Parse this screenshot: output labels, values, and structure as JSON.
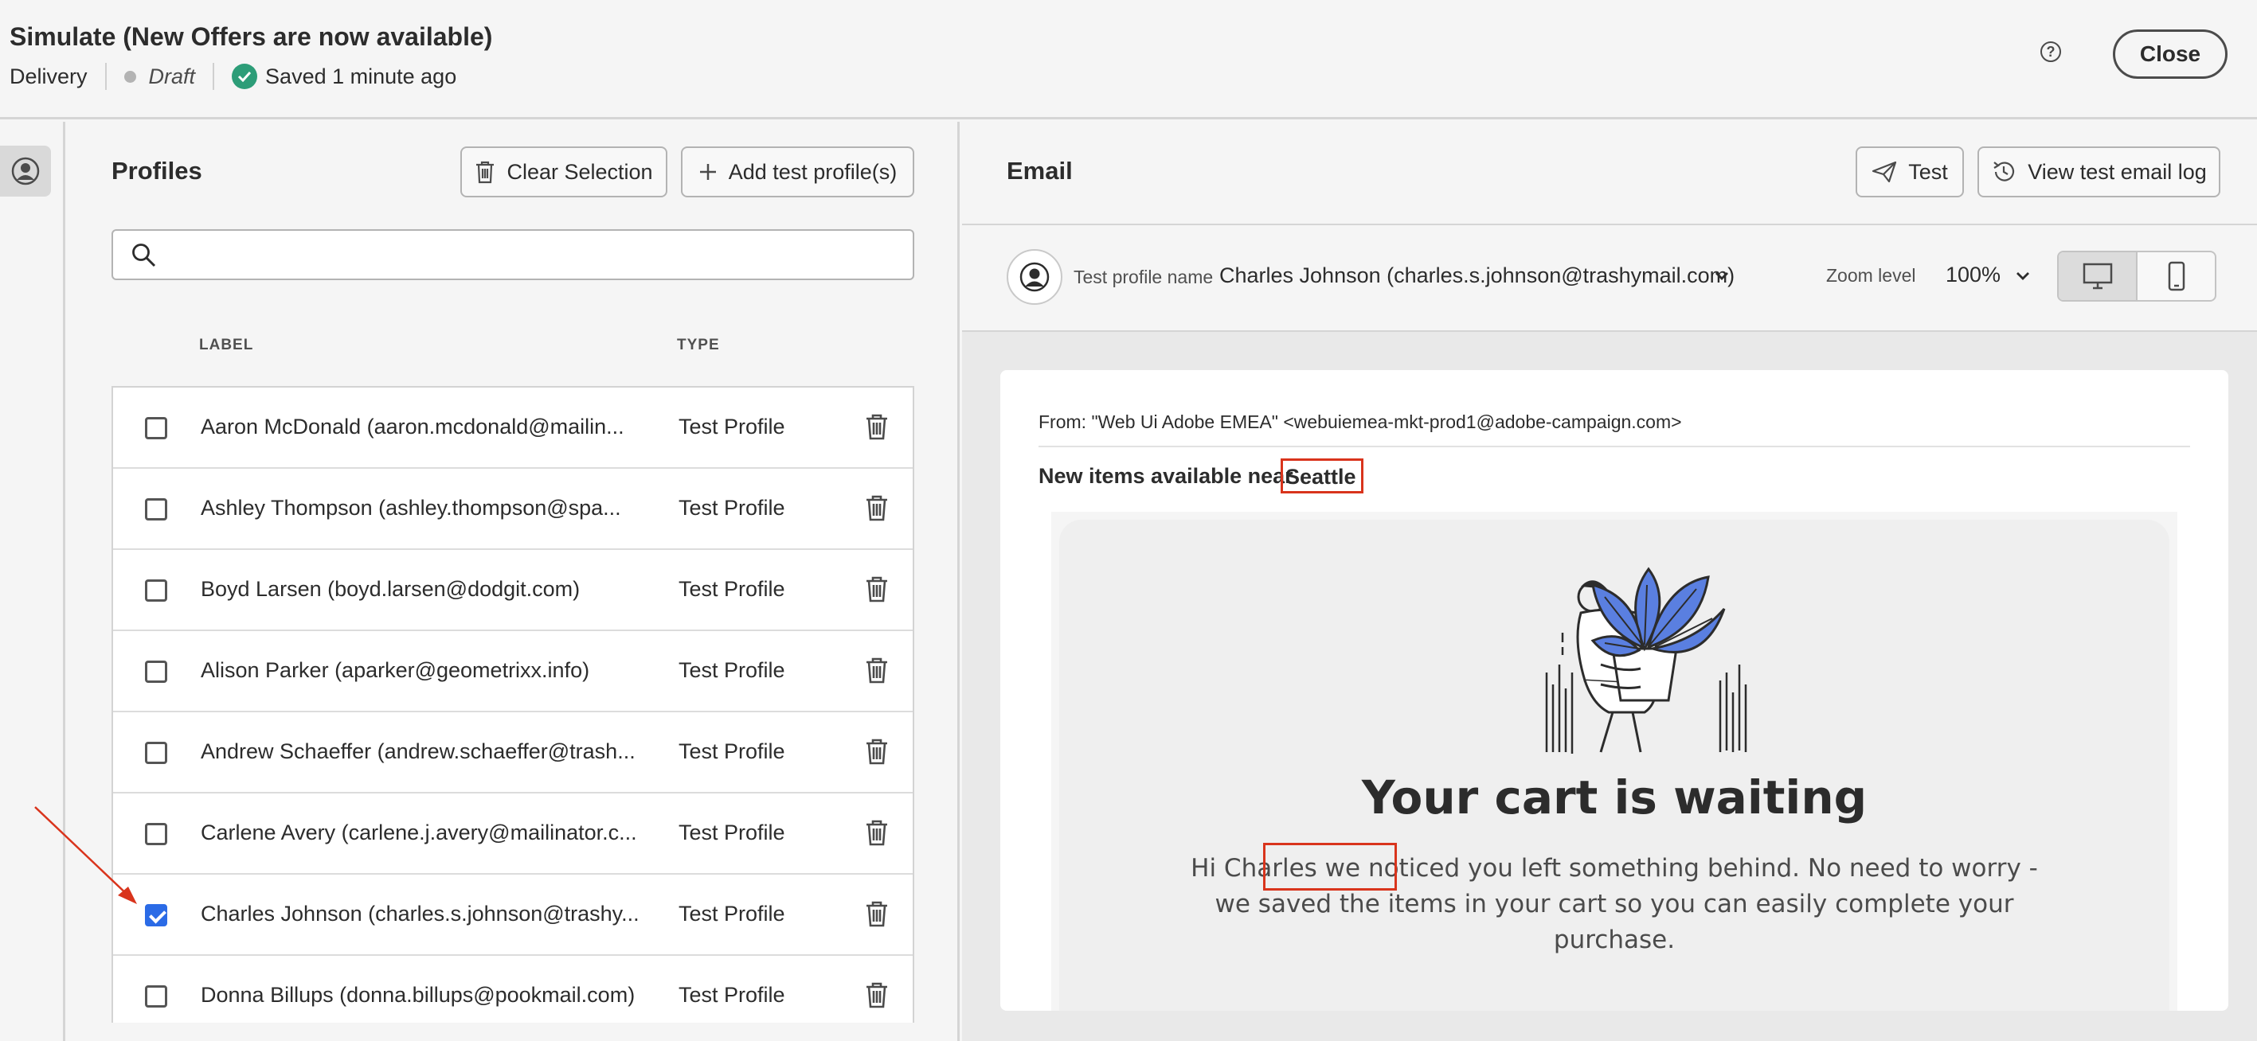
{
  "header": {
    "title": "Simulate (New Offers are now available)",
    "type": "Delivery",
    "status": "Draft",
    "saved": "Saved 1 minute ago",
    "close_label": "Close",
    "help_glyph": "?"
  },
  "profiles": {
    "title": "Profiles",
    "clear_label": "Clear Selection",
    "add_label": "Add test profile(s)",
    "search_placeholder": "",
    "columns": {
      "label": "LABEL",
      "type": "TYPE"
    },
    "rows": [
      {
        "label": "Aaron McDonald (aaron.mcdonald@mailin...",
        "type": "Test Profile",
        "checked": false
      },
      {
        "label": "Ashley Thompson (ashley.thompson@spa...",
        "type": "Test Profile",
        "checked": false
      },
      {
        "label": "Boyd Larsen (boyd.larsen@dodgit.com)",
        "type": "Test Profile",
        "checked": false
      },
      {
        "label": "Alison Parker (aparker@geometrixx.info)",
        "type": "Test Profile",
        "checked": false
      },
      {
        "label": "Andrew Schaeffer (andrew.schaeffer@trash...",
        "type": "Test Profile",
        "checked": false
      },
      {
        "label": "Carlene Avery (carlene.j.avery@mailinator.c...",
        "type": "Test Profile",
        "checked": false
      },
      {
        "label": "Charles Johnson (charles.s.johnson@trashy...",
        "type": "Test Profile",
        "checked": true
      },
      {
        "label": "Donna Billups (donna.billups@pookmail.com)",
        "type": "Test Profile",
        "checked": false
      }
    ]
  },
  "email": {
    "title": "Email",
    "test_label": "Test",
    "log_label": "View test email log",
    "test_profile_label": "Test profile name",
    "test_profile_value": "Charles Johnson (charles.s.johnson@trashymail.com)",
    "zoom_label": "Zoom level",
    "zoom_value": "100%",
    "from": "From: \"Web Ui Adobe EMEA\" <webuiemea-mkt-prod1@adobe-campaign.com>",
    "subject_prefix": "New items available near",
    "subject_city": "Seattle",
    "headline": "Your cart is waiting",
    "body_greeting": "Hi Charles",
    "body_line1_rest": " we noticed you left something behind. No need to worry -",
    "body_line2": "we saved the items in your cart so you can easily complete your",
    "body_line3": "purchase."
  },
  "colors": {
    "accent": "#2b6be6",
    "highlight": "#d9341c",
    "success": "#2d9d78",
    "plant": "#5a7fe0"
  }
}
